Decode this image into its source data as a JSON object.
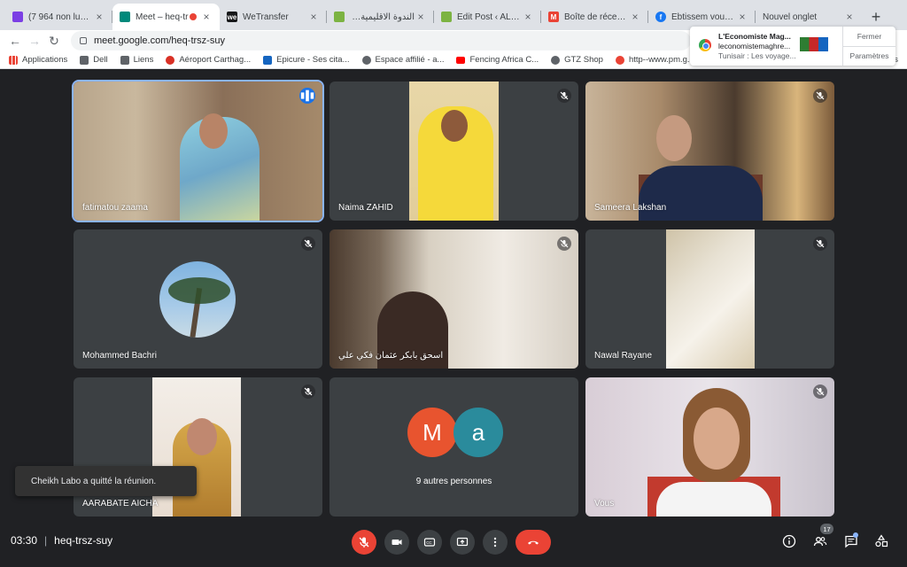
{
  "browser": {
    "tabs": [
      {
        "title": "(7 964 non lus) - s",
        "favicon": "mail-icon",
        "color": "#7b3fe4"
      },
      {
        "title": "Meet – heq-tr",
        "favicon": "meet-icon",
        "color": "#00897b",
        "active": true,
        "recording": true
      },
      {
        "title": "WeTransfer",
        "favicon": "wetransfer-icon",
        "color": "#17181a"
      },
      {
        "title": "الندوة الاقليمية الثانية حول",
        "favicon": "leaf-icon",
        "color": "#7cb342"
      },
      {
        "title": "Edit Post ‹ ALBIA",
        "favicon": "leaf-icon",
        "color": "#7cb342"
      },
      {
        "title": "Boîte de réception",
        "favicon": "gmail-icon",
        "color": "#ea4335"
      },
      {
        "title": "Ebtissem vous a e",
        "favicon": "facebook-icon",
        "color": "#1877f2"
      },
      {
        "title": "Nouvel onglet",
        "favicon": "",
        "color": "#dee1e6"
      }
    ],
    "new_tab": "+",
    "url": "meet.google.com/heq-trsz-suy",
    "bookmarks": [
      {
        "label": "Applications",
        "icon": "apps-grid-icon",
        "color": "#ea4335"
      },
      {
        "label": "Dell",
        "icon": "folder-icon",
        "color": "#5f6368"
      },
      {
        "label": "Liens",
        "icon": "folder-icon",
        "color": "#5f6368"
      },
      {
        "label": "Aéroport Carthag...",
        "icon": "x-circle-icon",
        "color": "#d93025"
      },
      {
        "label": "Epicure - Ses cita...",
        "icon": "epicure-icon",
        "color": "#1565c0"
      },
      {
        "label": "Espace affilié - a...",
        "icon": "globe-icon",
        "color": "#5f6368"
      },
      {
        "label": "Fencing Africa C...",
        "icon": "youtube-icon",
        "color": "#ff0000"
      },
      {
        "label": "GTZ Shop",
        "icon": "globe-icon",
        "color": "#5f6368"
      },
      {
        "label": "http--www.pm.g...",
        "icon": "record-icon",
        "color": "#ea4335"
      }
    ],
    "bookmarks_tail": "s"
  },
  "notification": {
    "title": "L'Economiste Mag...",
    "site": "leconomistemaghre...",
    "description": "Tunisair : Les voyage...",
    "close_label": "Fermer",
    "settings_label": "Paramètres"
  },
  "participants": [
    {
      "name": "fatimatou zaama",
      "speaking": true
    },
    {
      "name": "Naima ZAHID"
    },
    {
      "name": "Sameera Lakshan"
    },
    {
      "name": "Mohammed Bachri"
    },
    {
      "name": "اسحق بابكر عثمان فكي علي"
    },
    {
      "name": "Nawal Rayane"
    },
    {
      "name": "AARABATE AICHA"
    },
    {
      "name": "Vous"
    }
  ],
  "others": {
    "initial_1": "M",
    "initial_2": "a",
    "label": "9 autres personnes"
  },
  "snackbar": "Cheikh Labo a quitté la réunion.",
  "meeting": {
    "time": "03:30",
    "code": "heq-trsz-suy",
    "participant_count": "17"
  }
}
